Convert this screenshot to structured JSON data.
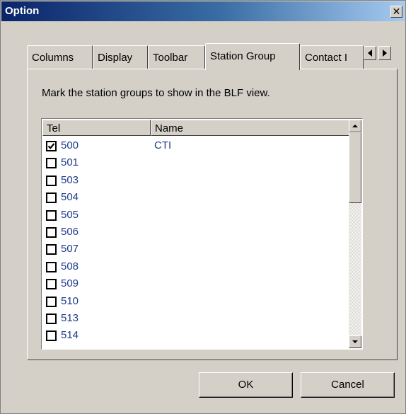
{
  "window": {
    "title": "Option",
    "close_glyph": "✕",
    "close_icon": "close-icon"
  },
  "tabs": [
    {
      "label": "Columns",
      "active": false
    },
    {
      "label": "Display",
      "active": false
    },
    {
      "label": "Toolbar",
      "active": false
    },
    {
      "label": "Station Group",
      "active": true
    },
    {
      "label": "Contact I",
      "active": false
    }
  ],
  "tab_scroll": {
    "left_icon": "triangle-left-icon",
    "right_icon": "triangle-right-icon"
  },
  "panel": {
    "instruction": "Mark the station groups to show in the BLF view."
  },
  "list": {
    "columns": [
      "Tel",
      "Name"
    ],
    "rows": [
      {
        "tel": "500",
        "name": "CTI",
        "checked": true
      },
      {
        "tel": "501",
        "name": "",
        "checked": false
      },
      {
        "tel": "503",
        "name": "",
        "checked": false
      },
      {
        "tel": "504",
        "name": "",
        "checked": false
      },
      {
        "tel": "505",
        "name": "",
        "checked": false
      },
      {
        "tel": "506",
        "name": "",
        "checked": false
      },
      {
        "tel": "507",
        "name": "",
        "checked": false
      },
      {
        "tel": "508",
        "name": "",
        "checked": false
      },
      {
        "tel": "509",
        "name": "",
        "checked": false
      },
      {
        "tel": "510",
        "name": "",
        "checked": false
      },
      {
        "tel": "513",
        "name": "",
        "checked": false
      },
      {
        "tel": "514",
        "name": "",
        "checked": false
      }
    ]
  },
  "buttons": {
    "ok": "OK",
    "cancel": "Cancel"
  },
  "colors": {
    "face": "#d4d0c8",
    "title_start": "#0a246a",
    "title_end": "#a6caf0",
    "list_text": "#1f3a8a"
  }
}
